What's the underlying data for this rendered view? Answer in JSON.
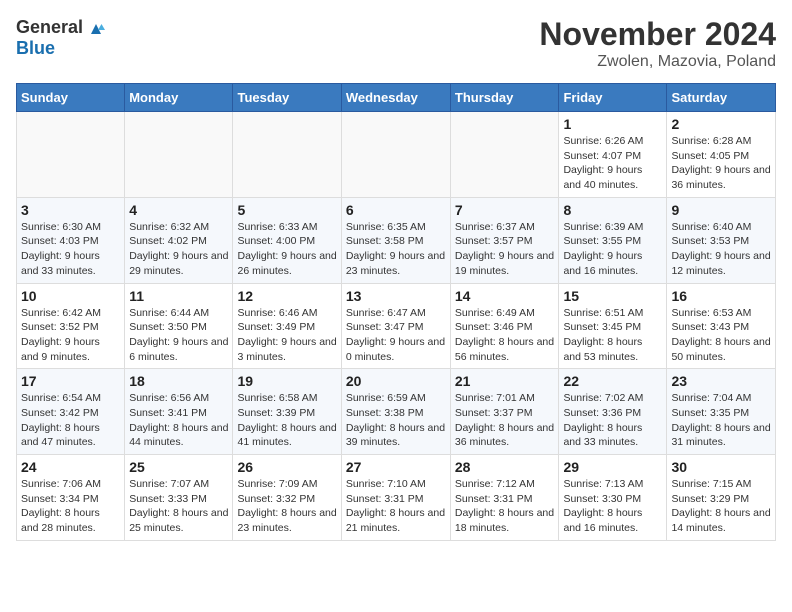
{
  "header": {
    "logo_general": "General",
    "logo_blue": "Blue",
    "title": "November 2024",
    "subtitle": "Zwolen, Mazovia, Poland"
  },
  "days_of_week": [
    "Sunday",
    "Monday",
    "Tuesday",
    "Wednesday",
    "Thursday",
    "Friday",
    "Saturday"
  ],
  "weeks": [
    [
      {
        "day": "",
        "info": ""
      },
      {
        "day": "",
        "info": ""
      },
      {
        "day": "",
        "info": ""
      },
      {
        "day": "",
        "info": ""
      },
      {
        "day": "",
        "info": ""
      },
      {
        "day": "1",
        "info": "Sunrise: 6:26 AM\nSunset: 4:07 PM\nDaylight: 9 hours and 40 minutes."
      },
      {
        "day": "2",
        "info": "Sunrise: 6:28 AM\nSunset: 4:05 PM\nDaylight: 9 hours and 36 minutes."
      }
    ],
    [
      {
        "day": "3",
        "info": "Sunrise: 6:30 AM\nSunset: 4:03 PM\nDaylight: 9 hours and 33 minutes."
      },
      {
        "day": "4",
        "info": "Sunrise: 6:32 AM\nSunset: 4:02 PM\nDaylight: 9 hours and 29 minutes."
      },
      {
        "day": "5",
        "info": "Sunrise: 6:33 AM\nSunset: 4:00 PM\nDaylight: 9 hours and 26 minutes."
      },
      {
        "day": "6",
        "info": "Sunrise: 6:35 AM\nSunset: 3:58 PM\nDaylight: 9 hours and 23 minutes."
      },
      {
        "day": "7",
        "info": "Sunrise: 6:37 AM\nSunset: 3:57 PM\nDaylight: 9 hours and 19 minutes."
      },
      {
        "day": "8",
        "info": "Sunrise: 6:39 AM\nSunset: 3:55 PM\nDaylight: 9 hours and 16 minutes."
      },
      {
        "day": "9",
        "info": "Sunrise: 6:40 AM\nSunset: 3:53 PM\nDaylight: 9 hours and 12 minutes."
      }
    ],
    [
      {
        "day": "10",
        "info": "Sunrise: 6:42 AM\nSunset: 3:52 PM\nDaylight: 9 hours and 9 minutes."
      },
      {
        "day": "11",
        "info": "Sunrise: 6:44 AM\nSunset: 3:50 PM\nDaylight: 9 hours and 6 minutes."
      },
      {
        "day": "12",
        "info": "Sunrise: 6:46 AM\nSunset: 3:49 PM\nDaylight: 9 hours and 3 minutes."
      },
      {
        "day": "13",
        "info": "Sunrise: 6:47 AM\nSunset: 3:47 PM\nDaylight: 9 hours and 0 minutes."
      },
      {
        "day": "14",
        "info": "Sunrise: 6:49 AM\nSunset: 3:46 PM\nDaylight: 8 hours and 56 minutes."
      },
      {
        "day": "15",
        "info": "Sunrise: 6:51 AM\nSunset: 3:45 PM\nDaylight: 8 hours and 53 minutes."
      },
      {
        "day": "16",
        "info": "Sunrise: 6:53 AM\nSunset: 3:43 PM\nDaylight: 8 hours and 50 minutes."
      }
    ],
    [
      {
        "day": "17",
        "info": "Sunrise: 6:54 AM\nSunset: 3:42 PM\nDaylight: 8 hours and 47 minutes."
      },
      {
        "day": "18",
        "info": "Sunrise: 6:56 AM\nSunset: 3:41 PM\nDaylight: 8 hours and 44 minutes."
      },
      {
        "day": "19",
        "info": "Sunrise: 6:58 AM\nSunset: 3:39 PM\nDaylight: 8 hours and 41 minutes."
      },
      {
        "day": "20",
        "info": "Sunrise: 6:59 AM\nSunset: 3:38 PM\nDaylight: 8 hours and 39 minutes."
      },
      {
        "day": "21",
        "info": "Sunrise: 7:01 AM\nSunset: 3:37 PM\nDaylight: 8 hours and 36 minutes."
      },
      {
        "day": "22",
        "info": "Sunrise: 7:02 AM\nSunset: 3:36 PM\nDaylight: 8 hours and 33 minutes."
      },
      {
        "day": "23",
        "info": "Sunrise: 7:04 AM\nSunset: 3:35 PM\nDaylight: 8 hours and 31 minutes."
      }
    ],
    [
      {
        "day": "24",
        "info": "Sunrise: 7:06 AM\nSunset: 3:34 PM\nDaylight: 8 hours and 28 minutes."
      },
      {
        "day": "25",
        "info": "Sunrise: 7:07 AM\nSunset: 3:33 PM\nDaylight: 8 hours and 25 minutes."
      },
      {
        "day": "26",
        "info": "Sunrise: 7:09 AM\nSunset: 3:32 PM\nDaylight: 8 hours and 23 minutes."
      },
      {
        "day": "27",
        "info": "Sunrise: 7:10 AM\nSunset: 3:31 PM\nDaylight: 8 hours and 21 minutes."
      },
      {
        "day": "28",
        "info": "Sunrise: 7:12 AM\nSunset: 3:31 PM\nDaylight: 8 hours and 18 minutes."
      },
      {
        "day": "29",
        "info": "Sunrise: 7:13 AM\nSunset: 3:30 PM\nDaylight: 8 hours and 16 minutes."
      },
      {
        "day": "30",
        "info": "Sunrise: 7:15 AM\nSunset: 3:29 PM\nDaylight: 8 hours and 14 minutes."
      }
    ]
  ]
}
